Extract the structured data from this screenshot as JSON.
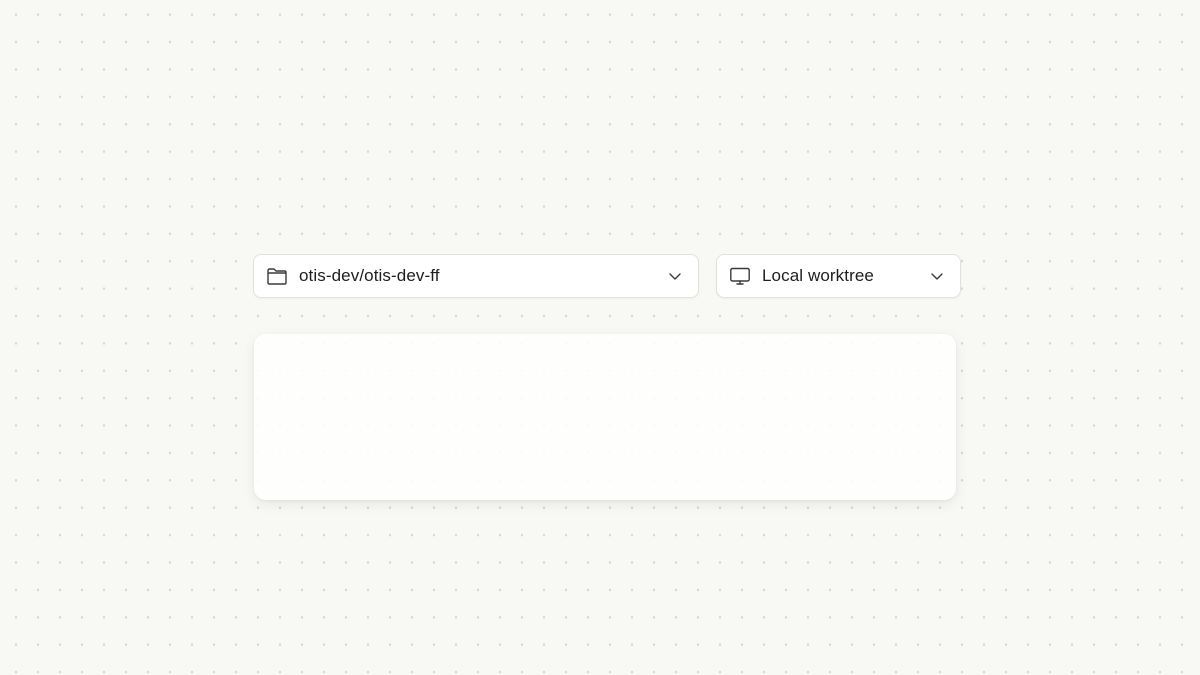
{
  "repo_selector": {
    "icon": "folder-icon",
    "label": "otis-dev/otis-dev-ff",
    "chevron": "chevron-down-icon"
  },
  "environment_selector": {
    "icon": "monitor-icon",
    "label": "Local worktree",
    "chevron": "chevron-down-icon"
  },
  "prompt_panel": {
    "content": ""
  },
  "colors": {
    "background": "#f8f8f5",
    "dot": "#d6d6d0",
    "card": "#ffffff",
    "border": "#e2e2dd",
    "text": "#1e1e1e",
    "icon": "#3a3a3a"
  }
}
